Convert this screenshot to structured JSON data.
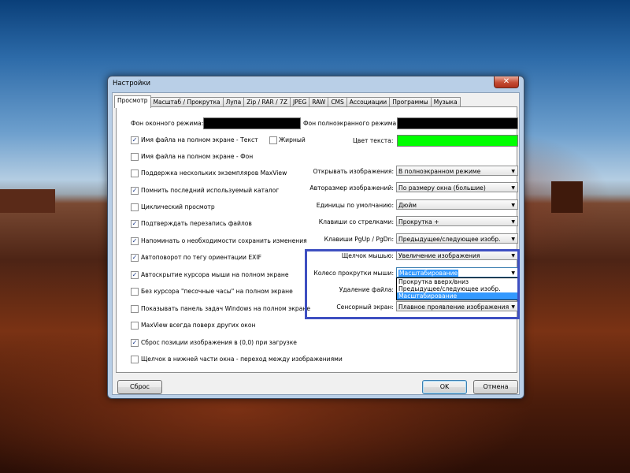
{
  "window": {
    "title": "Настройки",
    "close_glyph": "✕"
  },
  "tabs": [
    "Просмотр",
    "Масштаб / Прокрутка",
    "Лупа",
    "Zip / RAR / 7Z",
    "JPEG",
    "RAW",
    "CMS",
    "Ассоциации",
    "Программы",
    "Музыка"
  ],
  "colors": {
    "window_bg_label": "Фон оконного режима:",
    "fullscreen_bg_label": "Фон полноэкранного режима:",
    "text_color_label": "Цвет текста:",
    "window_bg": "#000000",
    "fullscreen_bg": "#000000",
    "text_color": "#00ff00"
  },
  "bold_label": "Жирный",
  "checkboxes": [
    {
      "label": "Имя файла на полном экране - Текст",
      "checked": true
    },
    {
      "label": "Имя файла на полном экране - Фон",
      "checked": false
    },
    {
      "label": "Поддержка нескольких экземпляров MaxView",
      "checked": false
    },
    {
      "label": "Помнить последний используемый каталог",
      "checked": true
    },
    {
      "label": "Циклический просмотр",
      "checked": false
    },
    {
      "label": "Подтверждать перезапись файлов",
      "checked": true
    },
    {
      "label": "Напоминать о необходимости сохранить изменения",
      "checked": true
    },
    {
      "label": "Автоповорот по тегу ориентации EXIF",
      "checked": true
    },
    {
      "label": "Автоскрытие курсора мыши на полном экране",
      "checked": true
    },
    {
      "label": "Без курсора \"песочные часы\" на полном экране",
      "checked": false
    },
    {
      "label": "Показывать панель задач Windows на полном экране",
      "checked": false
    },
    {
      "label": "MaxView всегда поверх других окон",
      "checked": false
    },
    {
      "label": "Сброс позиции изображения в (0,0) при загрузке",
      "checked": true
    },
    {
      "label": "Щелчок в нижней части окна - переход между изображениями",
      "checked": false
    }
  ],
  "combos": [
    {
      "label": "Открывать изображения:",
      "value": "В полноэкранном режиме"
    },
    {
      "label": "Авторазмер изображений:",
      "value": "По размеру окна (большие)"
    },
    {
      "label": "Единицы по умолчанию:",
      "value": "Дюйм"
    },
    {
      "label": "Клавиши со стрелками:",
      "value": "Прокрутка +"
    },
    {
      "label": "Клавиши PgUp / PgDn:",
      "value": "Предыдущее/следующее изобр."
    },
    {
      "label": "Щелчок мышью:",
      "value": "Увеличение изображения"
    },
    {
      "label": "Колесо прокрутки мыши:",
      "value": "Масштабирование"
    },
    {
      "label": "Удаление файла:",
      "value": ""
    },
    {
      "label": "Сенсорный экран:",
      "value": "Плавное проявление изображения"
    }
  ],
  "wheel_dropdown": {
    "options": [
      "Прокрутка вверх/вниз",
      "Предыдущее/следующее изобр.",
      "Масштабирование"
    ],
    "selected": "Масштабирование"
  },
  "buttons": {
    "reset": "Сброс",
    "ok": "OK",
    "cancel": "Отмена"
  },
  "check_glyph": "✓",
  "arrow_glyph": "▼"
}
